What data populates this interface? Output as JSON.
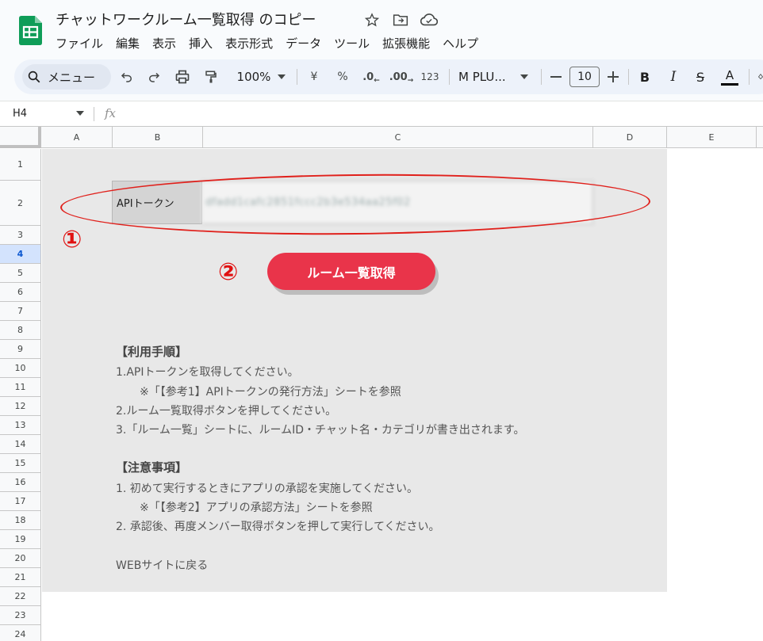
{
  "app": {
    "title": "チャットワークルーム一覧取得 のコピー",
    "menu": [
      "ファイル",
      "編集",
      "表示",
      "挿入",
      "表示形式",
      "データ",
      "ツール",
      "拡張機能",
      "ヘルプ"
    ]
  },
  "toolbar": {
    "search_label": "メニュー",
    "zoom": "100%",
    "currency": "¥",
    "percent": "%",
    "dec_decrease": ".0",
    "dec_increase": ".00",
    "number_format": "123",
    "font": "M PLU...",
    "font_size": "10",
    "bold": "B",
    "italic": "I",
    "strike": "S",
    "text_color": "A"
  },
  "formula_bar": {
    "cell_ref": "H4",
    "fx": "fx",
    "value": ""
  },
  "columns": [
    "A",
    "B",
    "C",
    "D",
    "E"
  ],
  "rows": [
    "1",
    "2",
    "3",
    "4",
    "5",
    "6",
    "7",
    "8",
    "9",
    "10",
    "11",
    "12",
    "13",
    "14",
    "15",
    "16",
    "17",
    "18",
    "19",
    "20",
    "21",
    "22",
    "23",
    "24"
  ],
  "selected_row": "4",
  "sheet": {
    "token_label": "APIトークン",
    "token_value": "dfadd1cafc2851fccc2b3e534aa25f02",
    "marker1": "①",
    "marker2": "②",
    "button_label": "ルーム一覧取得",
    "usage_heading": "【利用手順】",
    "usage": [
      "1.APIトークンを取得してください。",
      "※「【参考1】APIトークンの発行方法」シートを参照",
      "2.ルーム一覧取得ボタンを押してください。",
      "3.「ルーム一覧」シートに、ルームID・チャット名・カテゴリが書き出されます。"
    ],
    "notes_heading": "【注意事項】",
    "notes": [
      "1. 初めて実行するときにアプリの承認を実施してください。",
      "※「【参考2】アプリの承認方法」シートを参照",
      "2. 承認後、再度メンバー取得ボタンを押して実行してください。"
    ],
    "back_link": "WEBサイトに戻る"
  },
  "colors": {
    "button": "#e9344a",
    "annotation": "#e0201b",
    "sheets_green": "#0f9d58"
  }
}
